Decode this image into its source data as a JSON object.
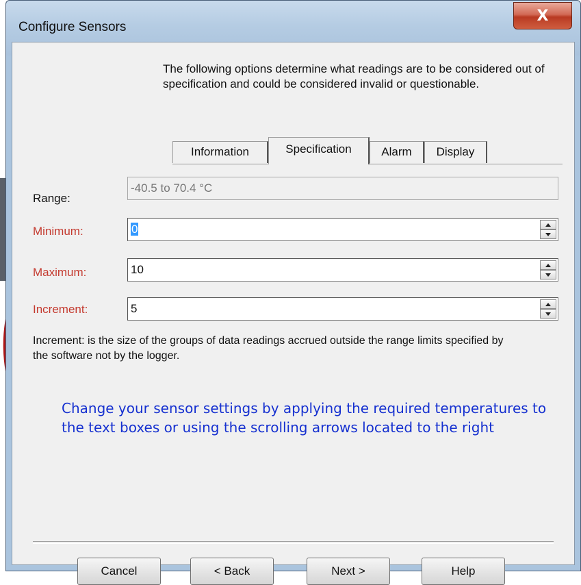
{
  "window": {
    "title": "Configure Sensors",
    "close_glyph": "X"
  },
  "intro_text": "The following options determine what readings are to be considered out of specification and could be considered invalid or questionable.",
  "tabs": [
    {
      "label": "Information",
      "active": false
    },
    {
      "label": "Specification",
      "active": true
    },
    {
      "label": "Alarm",
      "active": false
    },
    {
      "label": "Display",
      "active": false
    }
  ],
  "fields": {
    "range": {
      "label": "Range:",
      "value": "-40.5 to 70.4 °C"
    },
    "minimum": {
      "label": "Minimum:",
      "value": "0"
    },
    "maximum": {
      "label": "Maximum:",
      "value": "10"
    },
    "increment": {
      "label": "Increment:",
      "value": "5"
    }
  },
  "increment_note": "Increment: is the size of the groups of data readings accrued outside the range limits specified by the software not by the logger.",
  "instruction": "Change your sensor settings by applying the required temperatures to the text boxes or using the scrolling arrows located to the right",
  "buttons": {
    "cancel": "Cancel",
    "back": "< Back",
    "next": "Next >",
    "help": "Help"
  },
  "colors": {
    "required_label": "#c43a2f",
    "instruction_text": "#1530d0",
    "annotation_arrow": "#b01818"
  }
}
